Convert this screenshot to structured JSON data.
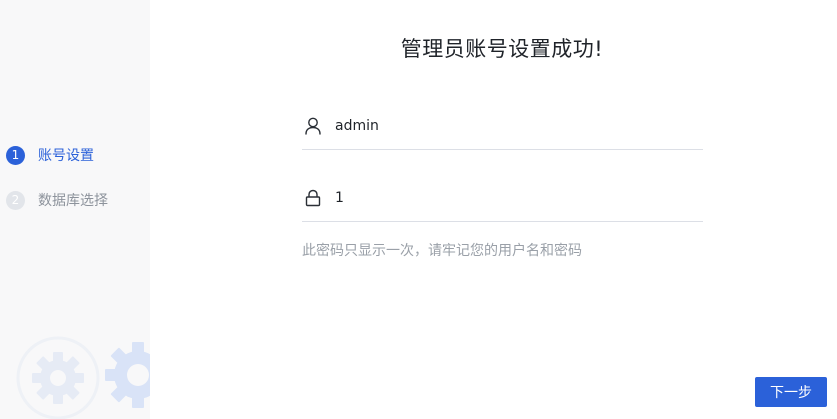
{
  "sidebar": {
    "steps": [
      {
        "number": "1",
        "label": "账号设置",
        "state": "active"
      },
      {
        "number": "2",
        "label": "数据库选择",
        "state": "inactive"
      }
    ],
    "decoration_icon": "gears-icon"
  },
  "main": {
    "title": "管理员账号设置成功!",
    "username": {
      "icon": "user-icon",
      "value": "admin"
    },
    "password": {
      "icon": "lock-icon",
      "value": "1"
    },
    "hint": "此密码只显示一次，请牢记您的用户名和密码",
    "next_label": "下一步"
  },
  "colors": {
    "accent": "#2b61d9",
    "sidebar_bg": "#f8f8f9",
    "muted_text": "#9aa0a8",
    "divider": "#dcdfe6"
  }
}
